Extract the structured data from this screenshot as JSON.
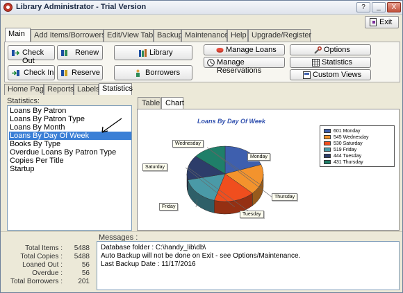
{
  "window": {
    "title": "Library Administrator - Trial Version"
  },
  "title_buttons": {
    "help": "?",
    "min": "_",
    "close": "X"
  },
  "exit_button": {
    "label": "Exit"
  },
  "main_tabs": [
    "Main",
    "Add Items/Borrowers",
    "Edit/View Table",
    "Backup",
    "Maintenance",
    "Help",
    "Upgrade/Register"
  ],
  "toolbar": {
    "check_out": "Check Out",
    "check_in": "Check In",
    "renew": "Renew",
    "reserve": "Reserve",
    "library": "Library",
    "borrowers": "Borrowers",
    "manage_loans": "Manage Loans",
    "manage_reservations": "Manage Reservations",
    "options": "Options",
    "statistics": "Statistics",
    "custom_views": "Custom Views"
  },
  "sub_tabs": [
    "Home Page",
    "Reports",
    "Labels",
    "Statistics"
  ],
  "statistics": {
    "label": "Statistics:",
    "items": [
      "Loans By Patron",
      "Loans By Patron Type",
      "Loans By Month",
      "Loans By Day Of Week",
      "Books By Type",
      "Overdue Loans By Patron Type",
      "Copies Per Title",
      "Startup"
    ],
    "selected_index": 3
  },
  "view_tabs": [
    "Table",
    "Chart"
  ],
  "chart_data": {
    "type": "pie",
    "title": "Loans By Day Of Week",
    "categories": [
      "Monday",
      "Wednesday",
      "Saturday",
      "Friday",
      "Tuesday",
      "Thursday"
    ],
    "values": [
      601,
      545,
      530,
      519,
      444,
      431
    ],
    "colors": [
      "#3e5fae",
      "#f3932d",
      "#f04e1e",
      "#4a9aa7",
      "#2d3d6a",
      "#1f7f69"
    ],
    "legend": [
      "601 Monday",
      "545 Wednesday",
      "530 Saturday",
      "519 Friday",
      "444 Tuesday",
      "431 Thursday"
    ],
    "legend_position": "top-right",
    "style": "3d"
  },
  "messages": {
    "label": "Messages :",
    "lines": [
      "Database folder : C:\\handy_lib\\db\\",
      "Auto Backup will not be done on Exit - see Options/Maintenance.",
      "Last Backup Date : 11/17/2016"
    ]
  },
  "totals": [
    {
      "label": "Total Items :",
      "value": "5488"
    },
    {
      "label": "Total Copies :",
      "value": "5488"
    },
    {
      "label": "Loaned Out :",
      "value": "56"
    },
    {
      "label": "Overdue :",
      "value": "56"
    },
    {
      "label": "Total Borrowers :",
      "value": "201"
    }
  ]
}
